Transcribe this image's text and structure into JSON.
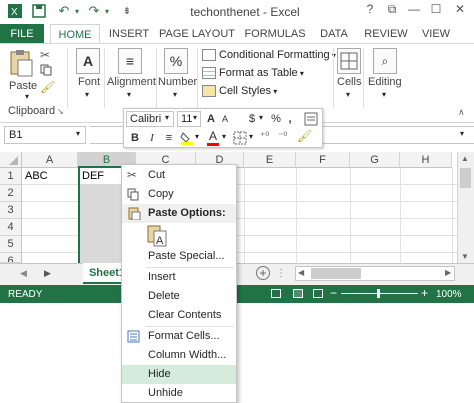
{
  "window": {
    "title": "techonthenet - Excel",
    "help": "?",
    "restore": "⧉",
    "minimize": "—",
    "maximize": "☐",
    "close": "✕"
  },
  "tabs": [
    "FILE",
    "HOME",
    "INSERT",
    "PAGE LAYOUT",
    "FORMULAS",
    "DATA",
    "REVIEW",
    "VIEW"
  ],
  "ribbon": {
    "paste_label": "Paste",
    "clipboard_label": "Clipboard",
    "font_label": "Font",
    "alignment_label": "Alignment",
    "number_label": "Number",
    "conditional_formatting": "Conditional Formatting",
    "format_as_table": "Format as Table",
    "cell_styles": "Cell Styles",
    "cells_label": "Cells",
    "editing_label": "Editing"
  },
  "formula_bar": {
    "name_box": "B1"
  },
  "mini_toolbar": {
    "font_name": "Calibri",
    "font_size": "11",
    "bold": "B",
    "italic": "I",
    "align": "≡",
    "font_color": "A",
    "currency": "$",
    "percent": "%",
    "comma": ",",
    "increase_font": "A",
    "decrease_font": "A"
  },
  "grid": {
    "columns": [
      "A",
      "B",
      "C",
      "D",
      "E",
      "F",
      "G",
      "H"
    ],
    "rows": [
      "1",
      "2",
      "3",
      "4",
      "5",
      "6"
    ],
    "cells": {
      "A1": "ABC",
      "B1": "DEF"
    }
  },
  "sheet": {
    "tab_name": "Sheet1",
    "nav_left": "◀",
    "nav_right": "▶",
    "add": "+"
  },
  "status": {
    "ready": "READY",
    "zoom": "100%",
    "minus": "−",
    "plus": "+"
  },
  "context_menu": {
    "items": [
      "Cut",
      "Copy",
      "Paste Options:",
      "Paste Special...",
      "Insert",
      "Delete",
      "Clear Contents",
      "Format Cells...",
      "Column Width...",
      "Hide",
      "Unhide"
    ]
  },
  "colors": {
    "excel_green": "#217346",
    "hover_green": "#d5ebdc",
    "selection_gray": "#d9d9d9"
  }
}
